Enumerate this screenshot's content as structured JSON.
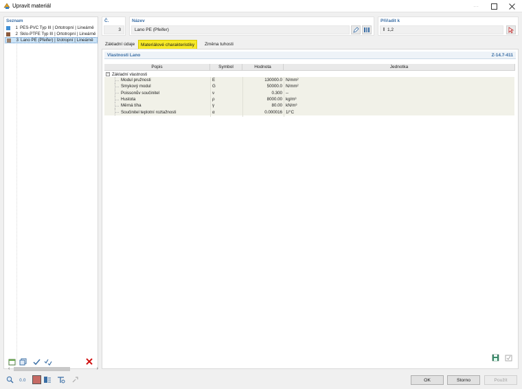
{
  "window": {
    "title": "Upravit materiál"
  },
  "left_panel": {
    "label": "Seznam",
    "items": [
      {
        "num": "1",
        "text": "PES-PVC Typ III | Ortotropní | Lineárně",
        "color": "#3f8fd6"
      },
      {
        "num": "2",
        "text": "Sklo-PTFE Typ III | Ortotropní | Lineárně",
        "color": "#8b5a3c"
      },
      {
        "num": "3",
        "text": "Lano PE (Pfeifer) | Izotropní | Lineárně",
        "color": "#9e8470"
      }
    ],
    "selected_index": 2
  },
  "fields": {
    "c_label": "Č.",
    "c_value": "3",
    "nazev_label": "Název",
    "nazev_value": "Lano PE (Pfeifer)",
    "prirad_label": "Přiřadit k",
    "prirad_value": "1,2"
  },
  "tabs": [
    {
      "label": "Základní údaje",
      "active": false
    },
    {
      "label": "Materiálové charakteristiky",
      "active": true
    },
    {
      "label": "Změna tuhosti",
      "active": false
    }
  ],
  "section": {
    "title": "Vlastnosti Lano",
    "code": "Z-14.7-411"
  },
  "table": {
    "headers": {
      "popis": "Popis",
      "symbol": "Symbol",
      "hodnota": "Hodnota",
      "jednotka": "Jednotka"
    },
    "group": "Základní vlastnosti",
    "rows": [
      {
        "popis": "Modul pružnosti",
        "symbol": "E",
        "value": "130000.0",
        "unit": "N/mm²"
      },
      {
        "popis": "Smykový modul",
        "symbol": "G",
        "value": "50000.0",
        "unit": "N/mm²"
      },
      {
        "popis": "Poissonův součinitel",
        "symbol": "ν",
        "value": "0.300",
        "unit": "--"
      },
      {
        "popis": "Hustota",
        "symbol": "ρ",
        "value": "8000.00",
        "unit": "kg/m³"
      },
      {
        "popis": "Měrná tíha",
        "symbol": "γ",
        "value": "80.00",
        "unit": "kN/m³"
      },
      {
        "popis": "Součinitel teplotní roztažnosti",
        "symbol": "α",
        "value": "0.000016",
        "unit": "1/°C"
      }
    ]
  },
  "buttons": {
    "ok": "OK",
    "storno": "Storno",
    "pouzit": "Použít"
  },
  "colors": {
    "active_tab": "#f7e925",
    "accent": "#3a6ea5"
  }
}
